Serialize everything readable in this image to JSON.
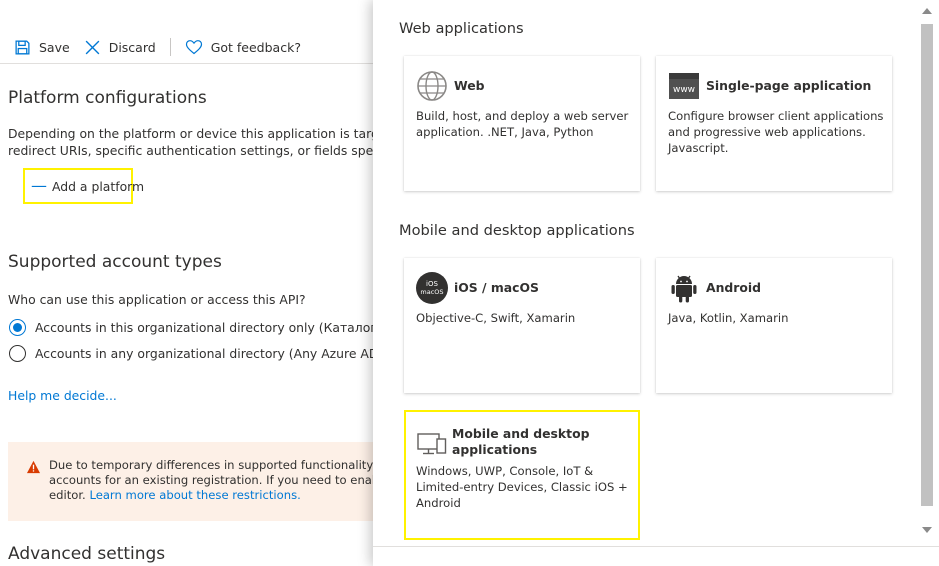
{
  "toolbar": {
    "save_label": "Save",
    "discard_label": "Discard",
    "feedback_label": "Got feedback?"
  },
  "platform": {
    "title": "Platform configurations",
    "desc_line1": "Depending on the platform or device this application is targ",
    "desc_line2": "redirect URIs, specific authentication settings, or fields specific to",
    "add_label": "Add a platform"
  },
  "accounts": {
    "title": "Supported account types",
    "question": "Who can use this application or access this API?",
    "options": [
      {
        "label": "Accounts in this organizational directory only (Каталог по у",
        "checked": true
      },
      {
        "label": "Accounts in any organizational directory (Any Azure AD dire",
        "checked": false
      }
    ],
    "help_link": "Help me decide..."
  },
  "warning": {
    "line1": "Due to temporary differences in supported functionality, we d",
    "line2": "accounts for an existing registration. If you need to enable pe",
    "line3_prefix": "editor.",
    "line3_link": "Learn more about these restrictions."
  },
  "advanced": {
    "title": "Advanced settings"
  },
  "panel": {
    "web_heading": "Web applications",
    "mobile_heading": "Mobile and desktop applications",
    "cards": {
      "web": {
        "title": "Web",
        "desc_line1": "Build, host, and deploy a web server",
        "desc_line2": "application. .NET, Java, Python"
      },
      "spa": {
        "title": "Single-page application",
        "icon_text": "www",
        "desc_line1": "Configure browser client applications",
        "desc_line2": "and progressive web applications.",
        "desc_line3": "Javascript."
      },
      "ios": {
        "title": "iOS / macOS",
        "icon_line1": "iOS",
        "icon_line2": "macOS",
        "desc_line1": "Objective-C, Swift, Xamarin"
      },
      "android": {
        "title": "Android",
        "desc_line1": "Java, Kotlin, Xamarin"
      },
      "desktop": {
        "title_line1": "Mobile and desktop",
        "title_line2": "applications",
        "desc_line1": "Windows, UWP, Console, IoT &",
        "desc_line2": "Limited-entry Devices, Classic iOS +",
        "desc_line3": "Android"
      }
    }
  },
  "colors": {
    "accent": "#0078d4",
    "highlight": "#fff200",
    "warning_bg": "#fdf0e7",
    "warning_icon": "#d83b01"
  }
}
